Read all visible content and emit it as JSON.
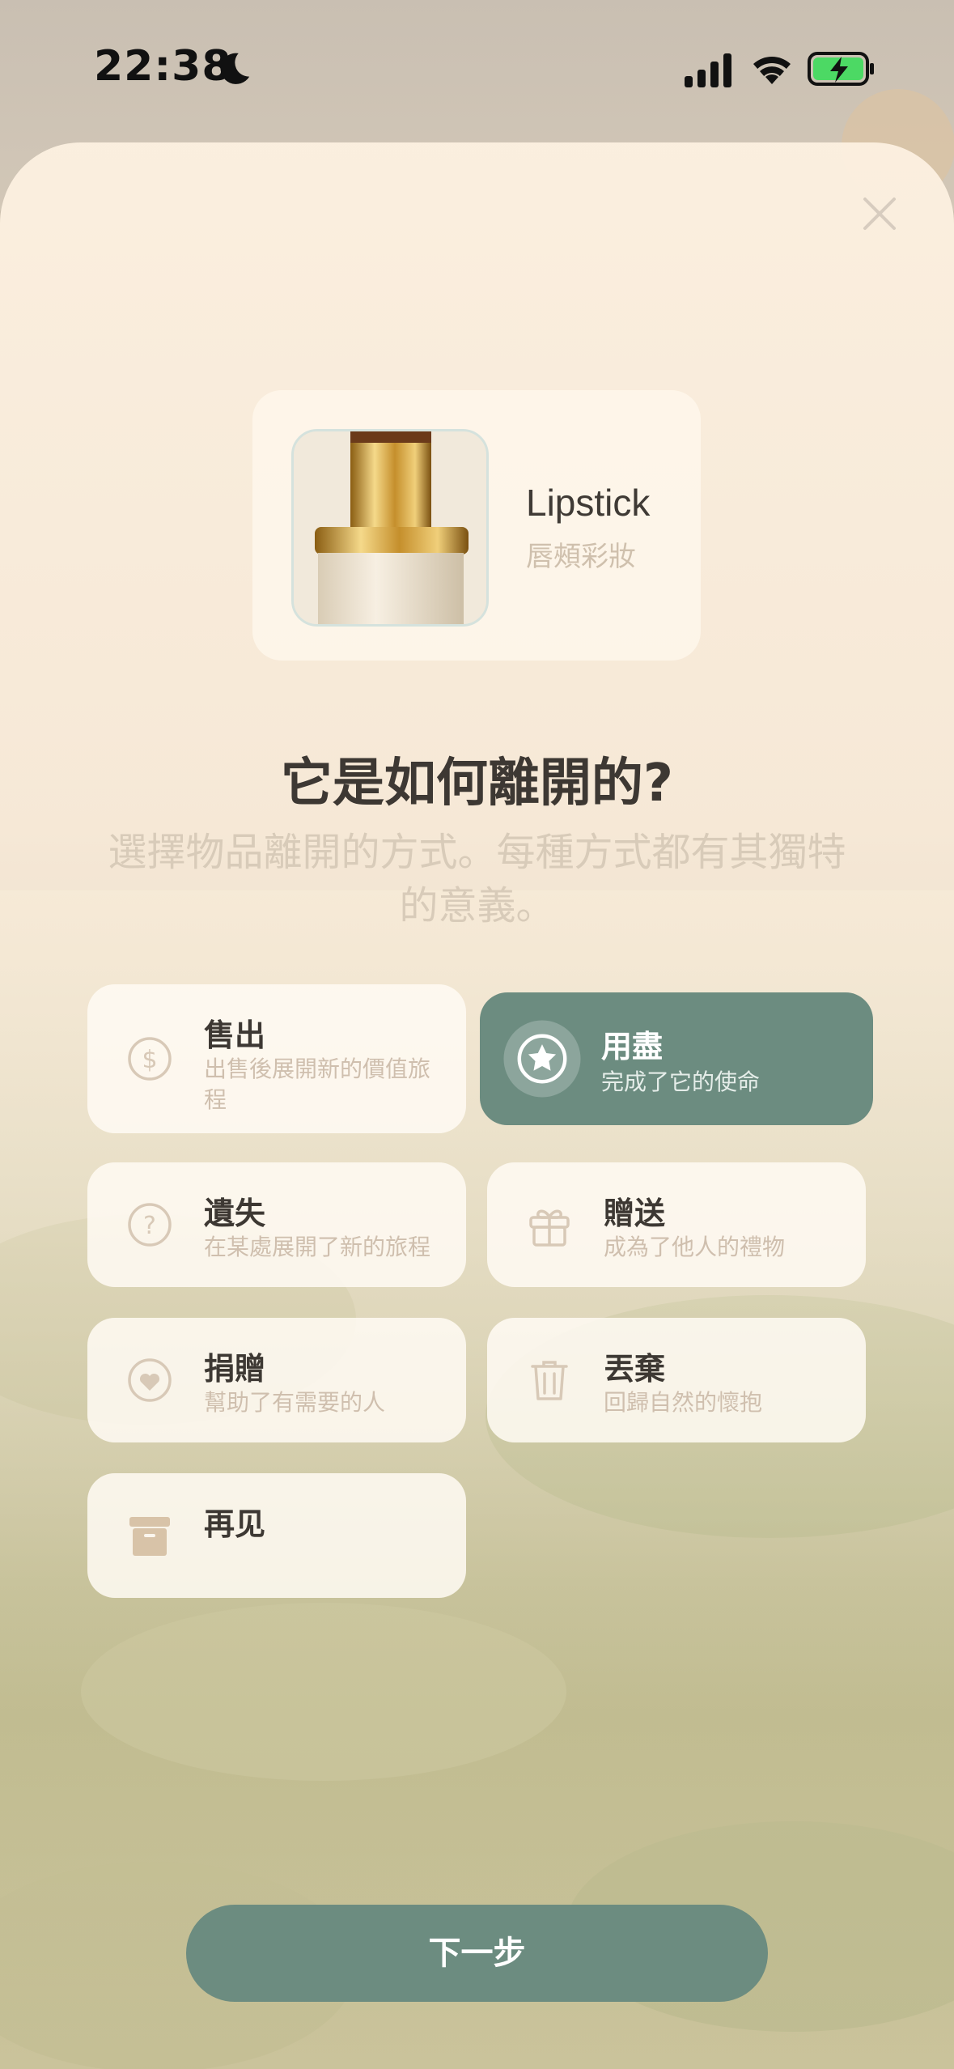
{
  "status_bar": {
    "time": "22:38",
    "icons": [
      "moon-icon",
      "signal-icon",
      "wifi-icon",
      "battery-charging-icon"
    ]
  },
  "item": {
    "name": "Lipstick",
    "category": "唇頰彩妝"
  },
  "question": "它是如何離開的?",
  "subtitle": "選擇物品離開的方式。每種方式都有其獨特的意義。",
  "options": [
    {
      "title": "售出",
      "desc": "出售後展開新的價值旅程",
      "icon": "dollar-icon",
      "selected": false
    },
    {
      "title": "用盡",
      "desc": "完成了它的使命",
      "icon": "star-icon",
      "selected": true
    },
    {
      "title": "遺失",
      "desc": "在某處展開了新的旅程",
      "icon": "question-icon",
      "selected": false
    },
    {
      "title": "贈送",
      "desc": "成為了他人的禮物",
      "icon": "gift-icon",
      "selected": false
    },
    {
      "title": "捐贈",
      "desc": "幫助了有需要的人",
      "icon": "heart-icon",
      "selected": false
    },
    {
      "title": "丟棄",
      "desc": "回歸自然的懷抱",
      "icon": "trash-icon",
      "selected": false
    },
    {
      "title": "再见",
      "desc": "",
      "icon": "archive-icon",
      "selected": false
    }
  ],
  "next_button": "下一步",
  "colors": {
    "accent": "#6c8c80",
    "text": "#3d3833",
    "muted": "#cfbfae"
  }
}
